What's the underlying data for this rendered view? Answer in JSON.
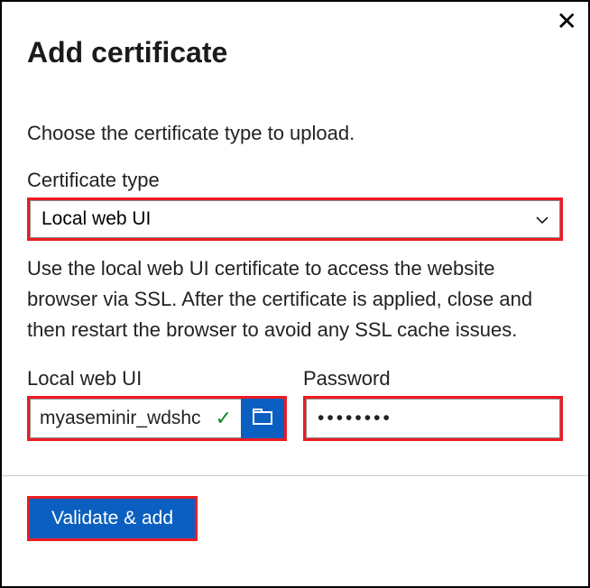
{
  "dialog": {
    "title": "Add certificate",
    "instruction": "Choose the certificate type to upload.",
    "close_label": "Close"
  },
  "cert_type": {
    "label": "Certificate type",
    "selected": "Local web UI",
    "description": "Use the local web UI certificate to access the website browser via SSL. After the certificate is applied, close and then restart the browser to avoid any SSL cache issues."
  },
  "file_field": {
    "label": "Local web UI",
    "value": "myaseminir_wdshc",
    "valid": true
  },
  "password_field": {
    "label": "Password",
    "value": "••••••••"
  },
  "actions": {
    "validate_add": "Validate & add"
  }
}
